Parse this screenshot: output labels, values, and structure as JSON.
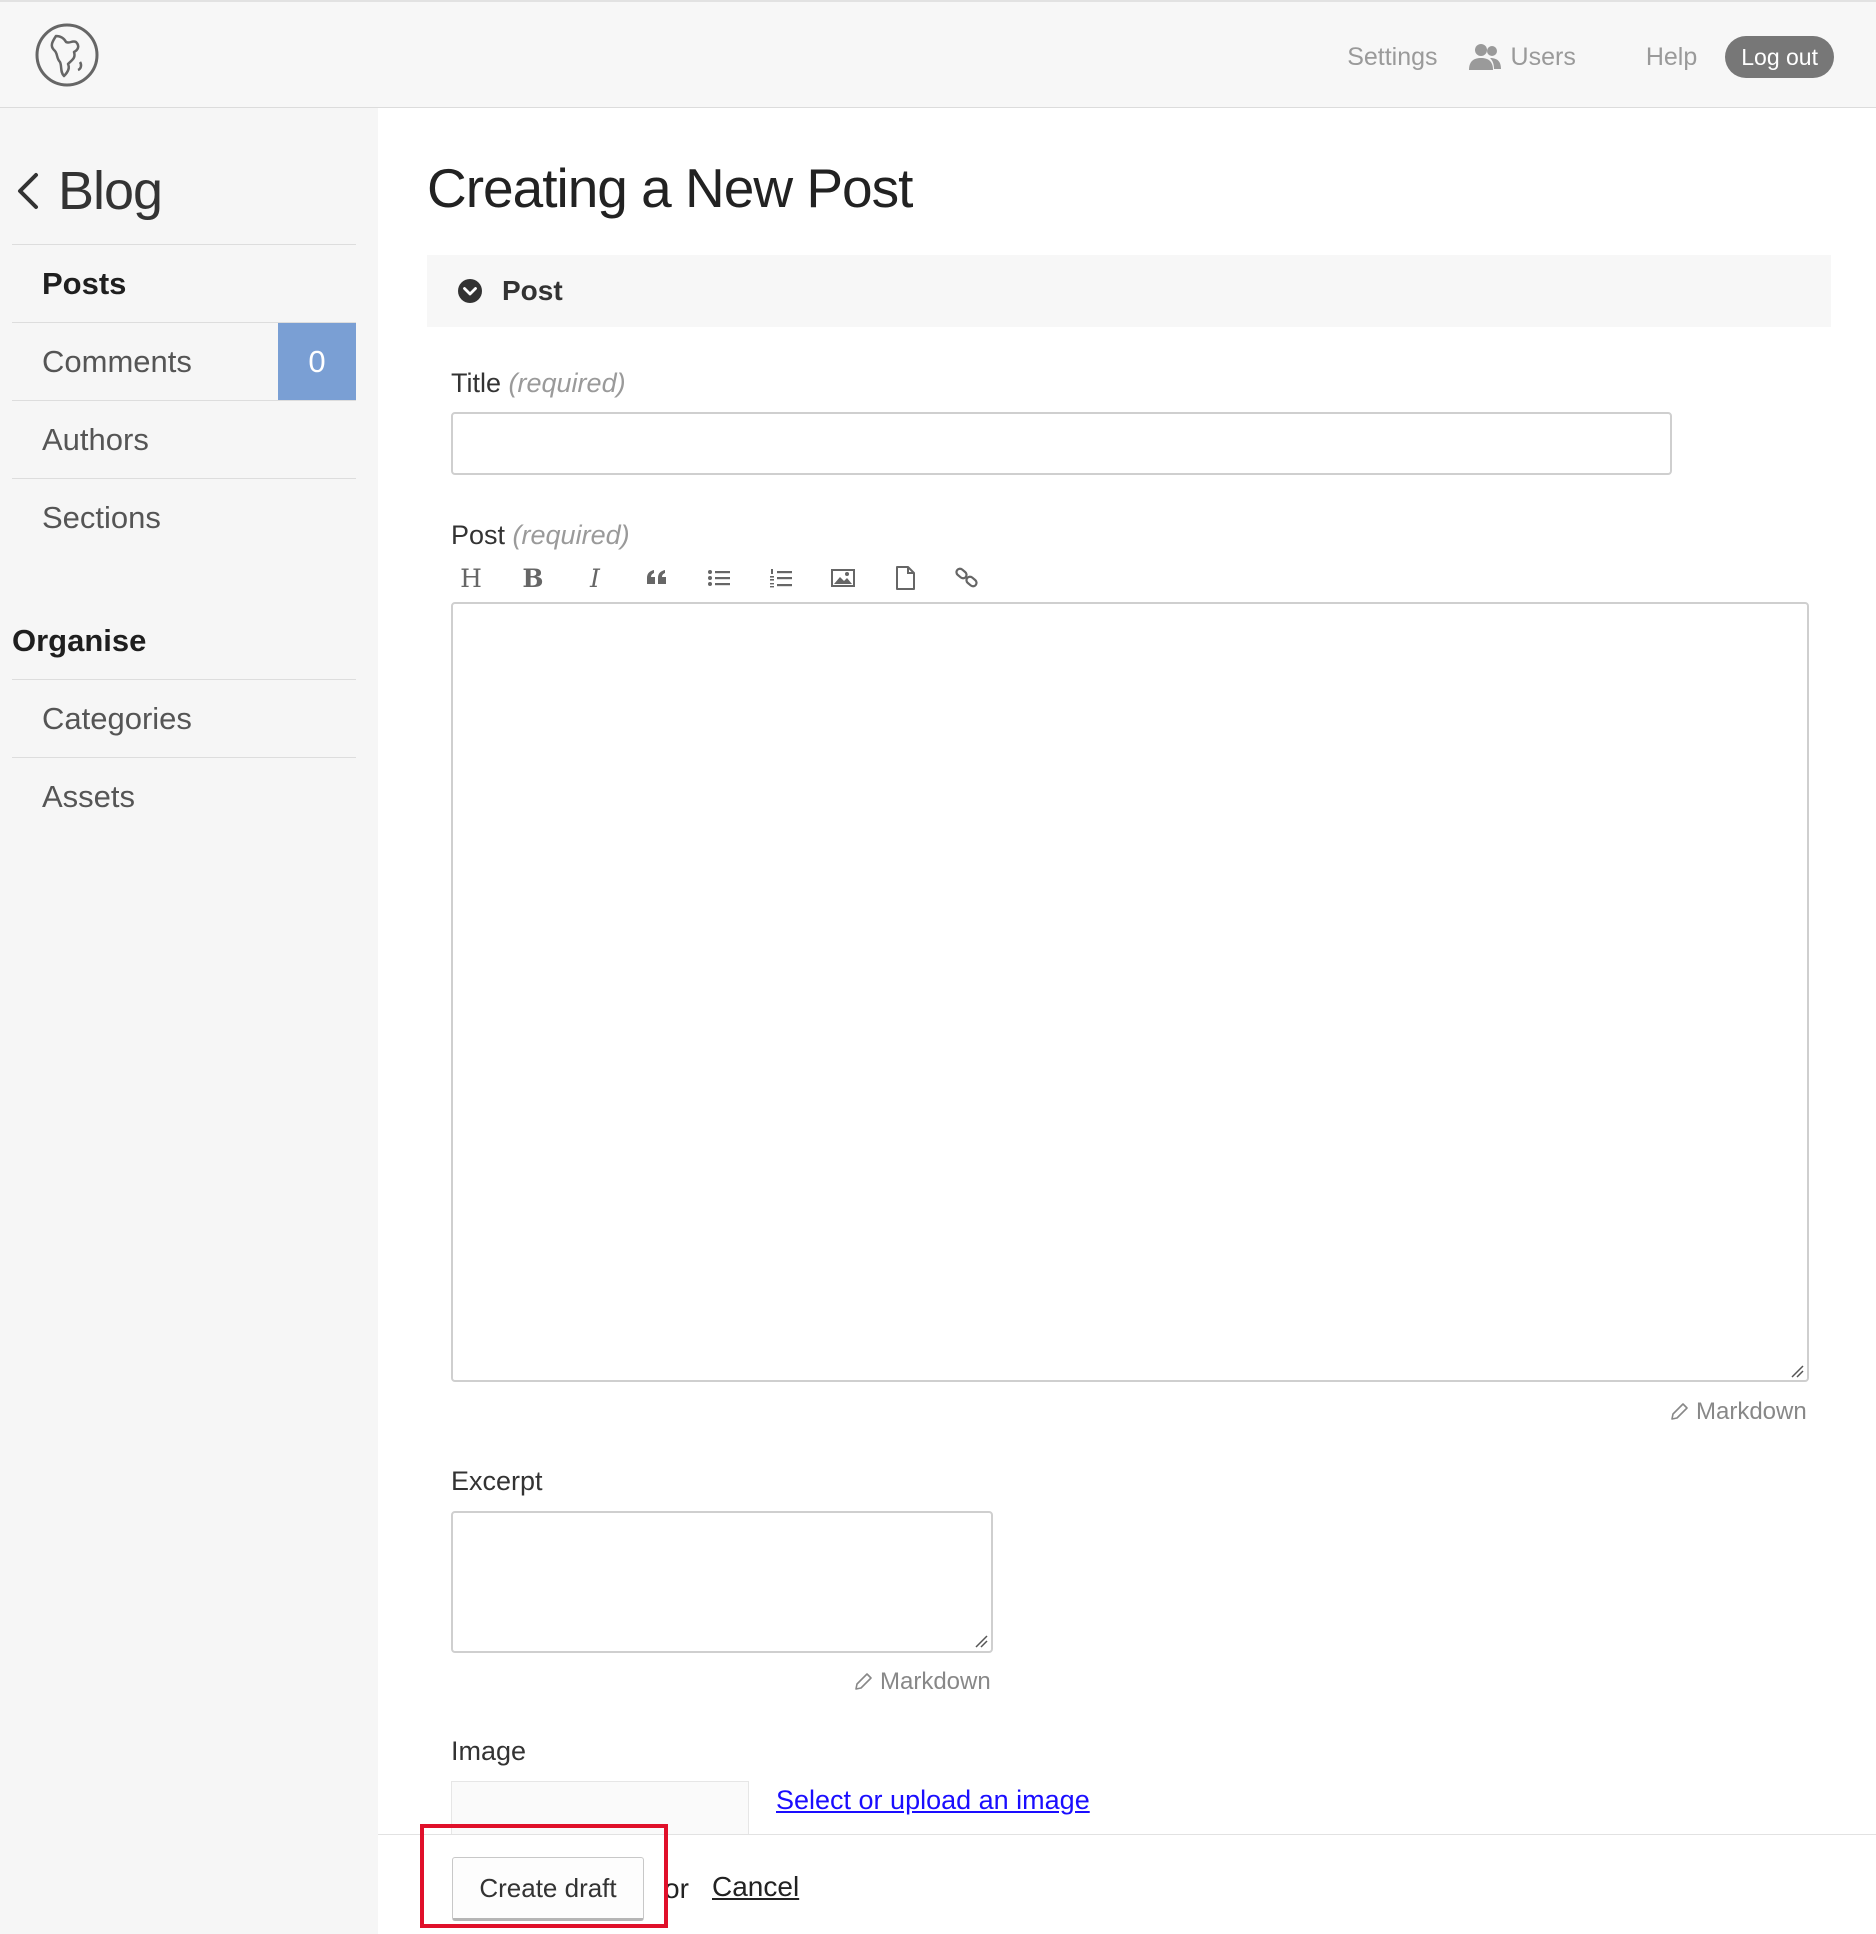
{
  "header": {
    "logo_icon": "globe-logo-icon",
    "nav": {
      "settings": "Settings",
      "users": "Users",
      "help": "Help",
      "logout": "Log out"
    }
  },
  "sidebar": {
    "back_label": "Blog",
    "items": [
      {
        "label": "Posts",
        "active": true
      },
      {
        "label": "Comments",
        "badge": "0"
      },
      {
        "label": "Authors"
      },
      {
        "label": "Sections"
      }
    ],
    "organise_heading": "Organise",
    "organise_items": [
      {
        "label": "Categories"
      },
      {
        "label": "Assets"
      }
    ],
    "badge_color": "#7a9fd4"
  },
  "main": {
    "title": "Creating a New Post",
    "section_label": "Post",
    "title_field": {
      "label": "Title",
      "required": "(required)",
      "value": ""
    },
    "post_field": {
      "label": "Post",
      "required": "(required)",
      "value": ""
    },
    "toolbar": {
      "heading": "H",
      "bold": "B",
      "italic": "I",
      "tools": [
        "heading",
        "bold",
        "italic",
        "quote-icon",
        "bullet-list-icon",
        "numbered-list-icon",
        "image-icon",
        "file-icon",
        "link-icon"
      ]
    },
    "markdown_label": "Markdown",
    "excerpt_field": {
      "label": "Excerpt",
      "value": ""
    },
    "image_field": {
      "label": "Image",
      "select_link": "Select or upload an image"
    }
  },
  "footer": {
    "create_label": "Create draft",
    "or_label": "or",
    "cancel_label": "Cancel",
    "highlight_color": "#e0102a"
  }
}
